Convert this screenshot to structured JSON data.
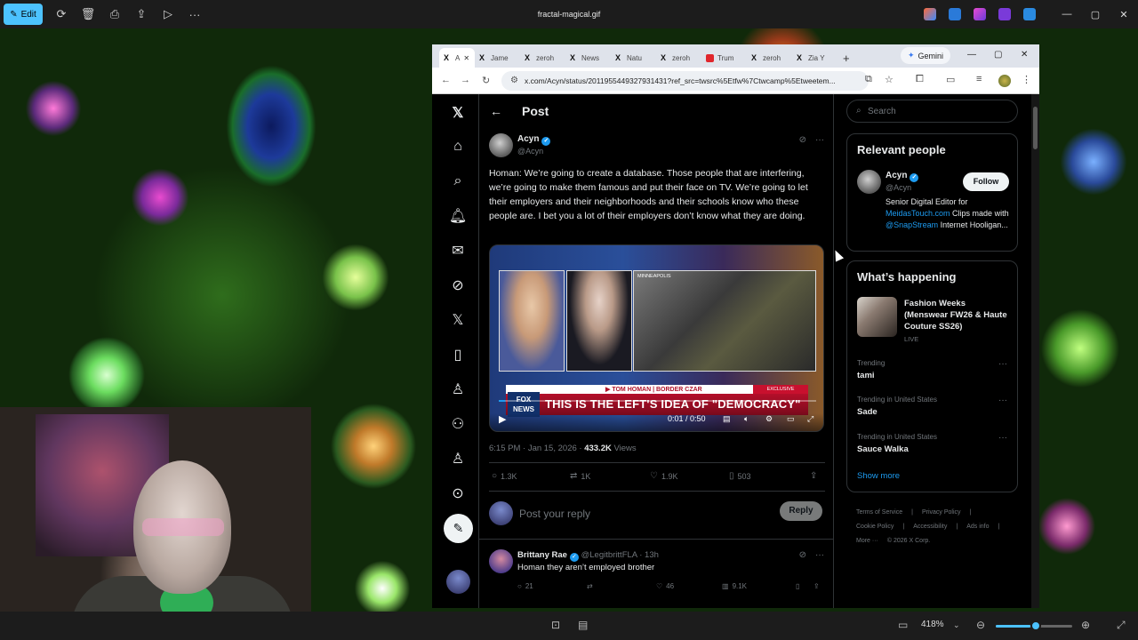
{
  "viewer": {
    "title": "fractal-magical.gif",
    "edit_label": "Edit",
    "zoom": "418%",
    "zoom_level_fraction": 0.45
  },
  "browser": {
    "tabs": [
      {
        "icon": "x-icon",
        "label": "A",
        "active": true
      },
      {
        "icon": "x-icon",
        "label": "Jame"
      },
      {
        "icon": "x-icon",
        "label": "zeroh"
      },
      {
        "icon": "x-icon",
        "label": "News"
      },
      {
        "icon": "x-icon",
        "label": "Natu"
      },
      {
        "icon": "x-icon",
        "label": "zeroh"
      },
      {
        "icon": "youtube-icon",
        "label": "Trum"
      },
      {
        "icon": "x-icon",
        "label": "zeroh"
      },
      {
        "icon": "x-icon",
        "label": "Zia Y"
      }
    ],
    "gemini_label": "Gemini",
    "url": "x.com/Acyn/status/2011955449327931431?ref_src=twsrc%5Etfw%7Ctwcamp%5Etweetem..."
  },
  "post": {
    "header_title": "Post",
    "author_name": "Acyn",
    "author_handle": "@Acyn",
    "text": "Homan: We’re going to create a database. Those people that are interfering, we’re going to make them famous and put their face on TV. We’re going to let their employers and their neighborhoods and their schools know who these people are. I bet you a lot of their employers don’t know what they are doing.",
    "video": {
      "chyron_name": "▶ TOM HOMAN | BORDER CZAR",
      "exclusive": "EXCLUSIVE",
      "chyron_text": "THIS IS THE LEFT'S IDEA OF \"DEMOCRACY\"",
      "logo": "FOX NEWS",
      "location_tag": "MINNEAPOLIS",
      "time": "0:01 / 0:50",
      "progress_fraction": 0.02
    },
    "time": "6:15 PM · Jan 15, 2026 · ",
    "views_count": "433.2K",
    "views_label": " Views",
    "stats": {
      "replies": "1.3K",
      "reposts": "1K",
      "likes": "1.9K",
      "bookmarks": "503"
    },
    "reply_placeholder": "Post your reply",
    "reply_button": "Reply"
  },
  "comment": {
    "name": "Brittany Rae",
    "meta": " @LegitbrittFLA · 13h",
    "text": "Homan they aren’t employed brother",
    "replies": "21",
    "likes": "46",
    "views": "9.1K"
  },
  "sidebar": {
    "search_placeholder": "Search",
    "relevant_title": "Relevant people",
    "rp_name": "Acyn",
    "rp_handle": "@Acyn",
    "follow": "Follow",
    "bio_1": "Senior Digital Editor for ",
    "bio_link_1": "MeidasTouch.com",
    "bio_2": " Clips made with ",
    "bio_link_2": "@SnapStream",
    "bio_3": " Internet Hooligan...",
    "happening_title": "What’s happening",
    "featured_title": "Fashion Weeks (Menswear FW26 & Haute Couture SS26)",
    "featured_status": "LIVE",
    "trends": [
      {
        "context": "Trending",
        "name": "tami"
      },
      {
        "context": "Trending in United States",
        "name": "Sade"
      },
      {
        "context": "Trending in United States",
        "name": "Sauce Walka"
      }
    ],
    "show_more": "Show more",
    "footer": [
      "Terms of Service",
      "|",
      "Privacy Policy",
      "|",
      "Cookie Policy",
      "|",
      "Accessibility",
      "|",
      "Ads info",
      "|",
      "More ···",
      "© 2026 X Corp."
    ]
  }
}
